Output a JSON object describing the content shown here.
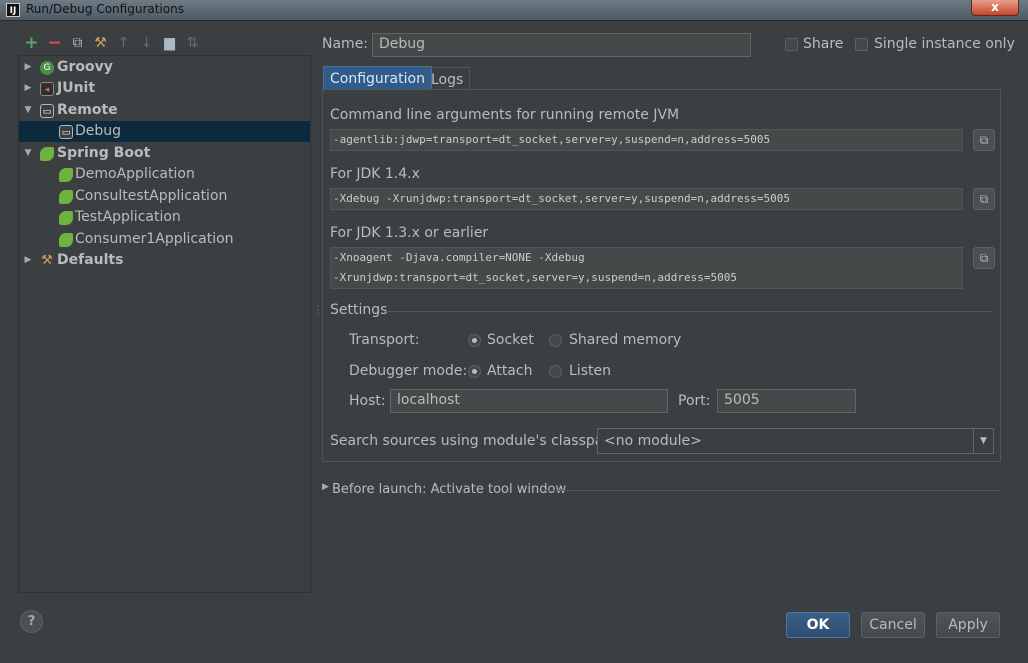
{
  "window": {
    "title": "Run/Debug Configurations",
    "app_icon": "IJ",
    "close": "x"
  },
  "toolbar": {
    "add": "+",
    "remove": "−",
    "copy": "⧉",
    "edit": "⚒",
    "up": "↑",
    "down": "↓",
    "folder": "▆",
    "sort": "⇅"
  },
  "tree": [
    {
      "label": "Groovy",
      "icon": "groovy-icon",
      "glyph": "G",
      "expanded": false,
      "bold": true
    },
    {
      "label": "JUnit",
      "icon": "junit-icon",
      "glyph": "◂",
      "expanded": false,
      "bold": true
    },
    {
      "label": "Remote",
      "icon": "remote-icon",
      "glyph": "▭",
      "expanded": true,
      "bold": true
    },
    {
      "label": "Debug",
      "icon": "remote-icon",
      "glyph": "▭",
      "child": true,
      "selected": true
    },
    {
      "label": "Spring Boot",
      "icon": "spring-boot-icon",
      "glyph": "",
      "expanded": true,
      "bold": true
    },
    {
      "label": "DemoApplication",
      "icon": "spring-boot-icon",
      "glyph": "",
      "child": true
    },
    {
      "label": "ConsultestApplication",
      "icon": "spring-boot-icon",
      "glyph": "",
      "child": true
    },
    {
      "label": "TestApplication",
      "icon": "spring-boot-icon",
      "glyph": "",
      "child": true
    },
    {
      "label": "Consumer1Application",
      "icon": "spring-boot-icon",
      "glyph": "",
      "child": true
    },
    {
      "label": "Defaults",
      "icon": "defaults-icon",
      "glyph": "⚒",
      "expanded": false,
      "bold": true
    }
  ],
  "help": "?",
  "form": {
    "name_label": "Name:",
    "name_value": "Debug",
    "share_label": "Share",
    "single_instance_label": "Single instance only"
  },
  "tabs": [
    {
      "label": "Configuration",
      "active": true
    },
    {
      "label": "Logs",
      "active": false
    }
  ],
  "config": {
    "cmd_label": "Command line arguments for running remote JVM",
    "cmd_value": "-agentlib:jdwp=transport=dt_socket,server=y,suspend=n,address=5005",
    "jdk14_label": "For JDK 1.4.x",
    "jdk14_value": "-Xdebug -Xrunjdwp:transport=dt_socket,server=y,suspend=n,address=5005",
    "jdk13_label": "For JDK 1.3.x or earlier",
    "jdk13_line1": "-Xnoagent -Djava.compiler=NONE -Xdebug",
    "jdk13_line2": "-Xrunjdwp:transport=dt_socket,server=y,suspend=n,address=5005",
    "settings_label": "Settings",
    "transport_label": "Transport:",
    "transport_socket": "Socket",
    "transport_shared": "Shared memory",
    "debugger_mode_label": "Debugger mode:",
    "mode_attach": "Attach",
    "mode_listen": "Listen",
    "host_label": "Host:",
    "host_value": "localhost",
    "port_label": "Port:",
    "port_value": "5005",
    "search_label": "Search sources using module's classpath:",
    "module_value": "<no module>"
  },
  "before_launch": "Before launch: Activate tool window",
  "buttons": {
    "ok": "OK",
    "cancel": "Cancel",
    "apply": "Apply"
  }
}
